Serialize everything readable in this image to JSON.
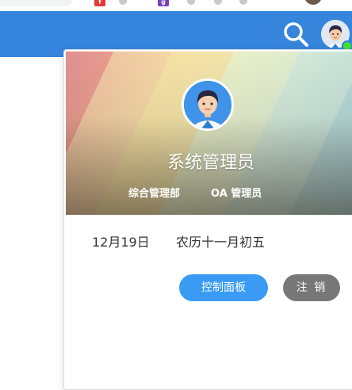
{
  "browser": {
    "extensions": [
      {
        "icon": "red-extension-icon",
        "glyph": "f",
        "color": "#e53935"
      },
      {
        "icon": "purple-extension-icon",
        "glyph": "g",
        "color": "#7b3fb8"
      }
    ]
  },
  "header": {
    "search_icon": "search-icon",
    "avatar_icon": "user-avatar-icon",
    "status": "online",
    "colors": {
      "bar": "#3585dc",
      "online": "#44e02c"
    }
  },
  "user_card": {
    "name": "系统管理员",
    "department": "综合管理部",
    "role": "OA 管理员",
    "date": "12月19日",
    "lunar_date": "农历十一月初五",
    "control_panel_label": "控制面板",
    "logout_label": "注 销",
    "colors": {
      "primary_button": "#3a9bf4",
      "secondary_button": "#777777"
    }
  }
}
